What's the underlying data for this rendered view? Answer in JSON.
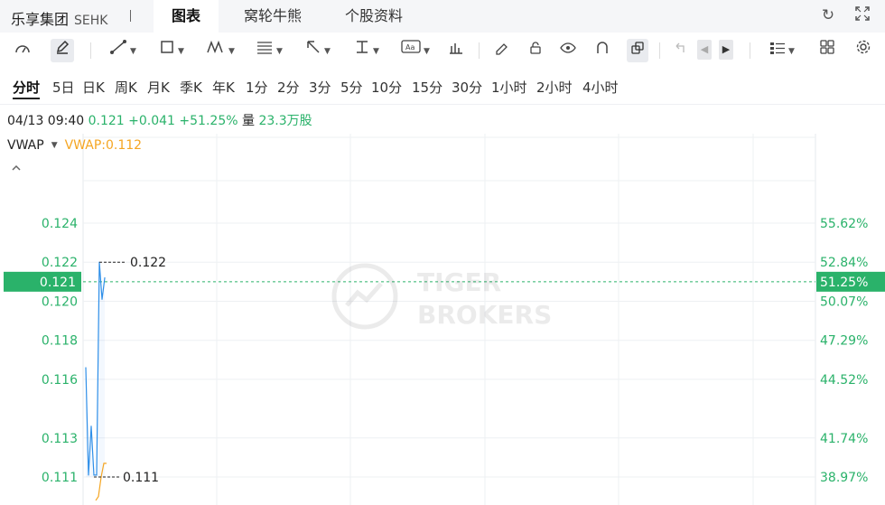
{
  "header": {
    "stock_name": "乐享集团",
    "stock_code": "SEHK",
    "tabs": [
      {
        "label": "图表",
        "active": true
      },
      {
        "label": "窝轮牛熊",
        "active": false
      },
      {
        "label": "个股资料",
        "active": false
      }
    ],
    "icons": [
      "refresh-icon",
      "fullscreen-icon"
    ]
  },
  "toolbar": {
    "tools": [
      "indicator-gauge-icon",
      "draw-pen-icon",
      "line-tool-icon",
      "rectangle-tool-icon",
      "pattern-tool-icon",
      "fib-tool-icon",
      "arrow-tool-icon",
      "measure-tool-icon",
      "text-tool-icon",
      "bar-tool-icon",
      "eraser-icon",
      "lock-icon",
      "eye-icon",
      "magnet-icon",
      "link-icon",
      "undo-icon",
      "prev-icon",
      "next-icon",
      "layout-icon",
      "grid-icon",
      "settings-icon"
    ]
  },
  "periods": [
    "分时",
    "5日",
    "日K",
    "周K",
    "月K",
    "季K",
    "年K",
    "1分",
    "2分",
    "3分",
    "5分",
    "10分",
    "15分",
    "30分",
    "1小时",
    "2小时",
    "4小时"
  ],
  "active_period": "分时",
  "quote": {
    "datetime": "04/13 09:40",
    "price": "0.121",
    "change": "+0.041",
    "change_pct": "+51.25%",
    "volume_label": "量",
    "volume": "23.3万股"
  },
  "indicator": {
    "name": "VWAP",
    "value_text": "VWAP:0.112"
  },
  "watermark": {
    "line1": "TIGER",
    "line2": "BROKERS"
  },
  "colors": {
    "green": "#2ab26a",
    "price_line": "#2f8fe8",
    "vwap_line": "#f5a623",
    "grid": "#eef0f3"
  },
  "chart_data": {
    "type": "line",
    "y_ticks_left": [
      "0.124",
      "0.122",
      "0.120",
      "0.118",
      "0.116",
      "0.113",
      "0.111"
    ],
    "y_ticks_right": [
      "55.62%",
      "52.84%",
      "50.07%",
      "47.29%",
      "44.52%",
      "41.74%",
      "38.97%"
    ],
    "y_tick_values": [
      0.124,
      0.122,
      0.12,
      0.118,
      0.116,
      0.113,
      0.111
    ],
    "ylim": [
      0.1098,
      0.1275
    ],
    "current_price": {
      "label": "0.121",
      "pct": "51.25%",
      "value": 0.121
    },
    "high_marker": {
      "label": "0.122",
      "value": 0.122
    },
    "low_marker": {
      "label": "0.111",
      "value": 0.111
    },
    "series": [
      {
        "kind": "price",
        "x": [
          0,
          1,
          2,
          3,
          4,
          5,
          6,
          7
        ],
        "values": [
          0.1166,
          0.1111,
          0.1136,
          0.1111,
          0.1111,
          0.122,
          0.1201,
          0.1212
        ]
      },
      {
        "kind": "vwap",
        "x": [
          3,
          4,
          5,
          6,
          7
        ],
        "values": [
          0.1098,
          0.11,
          0.111,
          0.1117,
          0.1117
        ]
      }
    ],
    "x_range": [
      0,
      330
    ],
    "grid": true
  }
}
